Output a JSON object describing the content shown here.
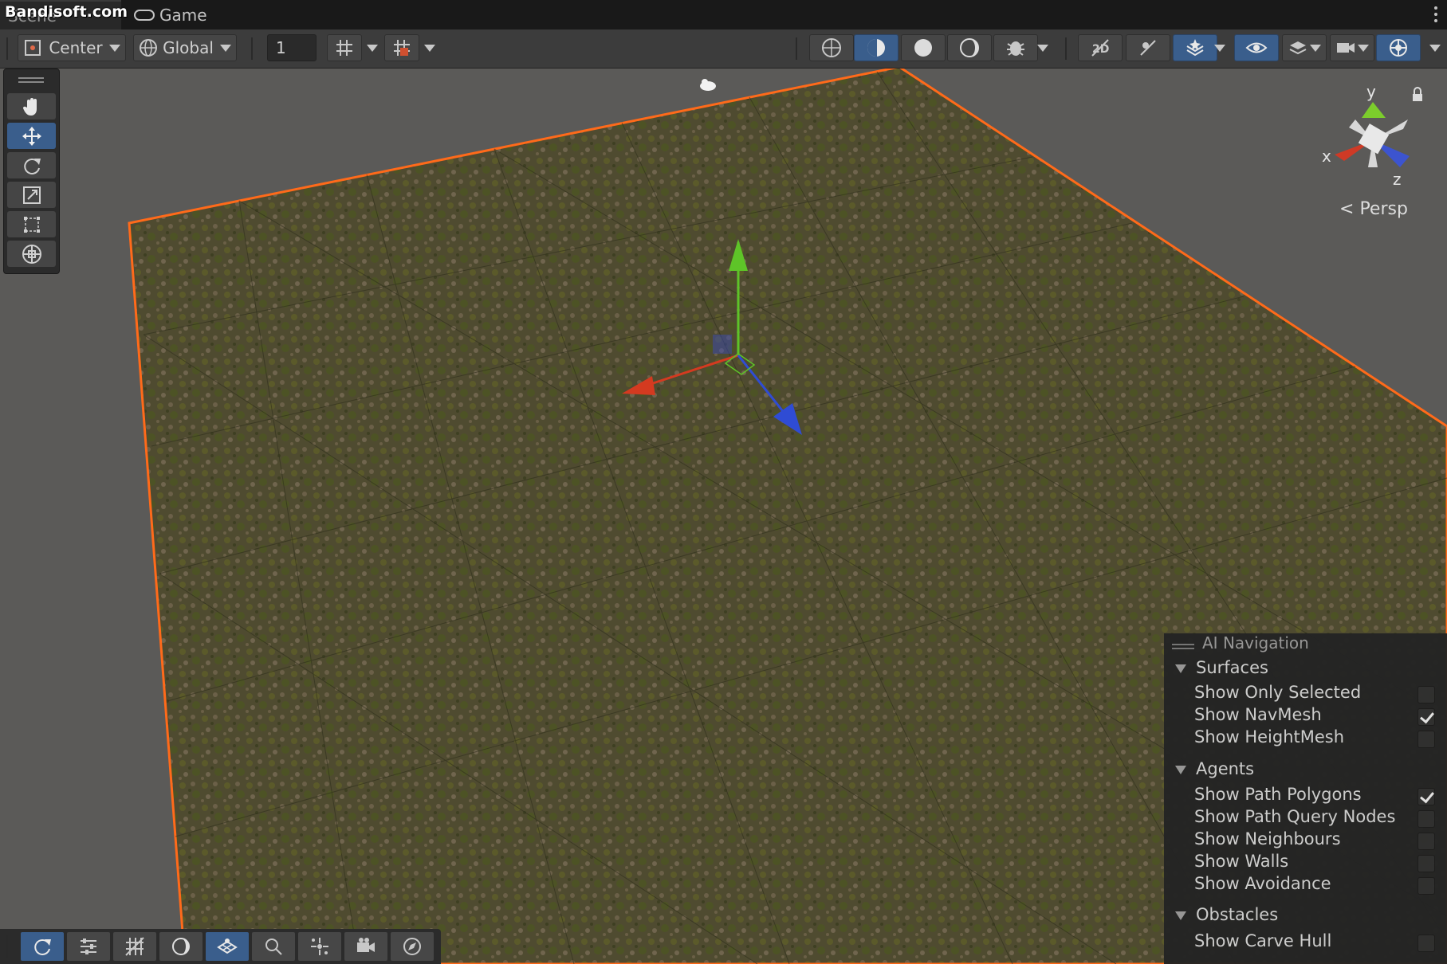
{
  "tabs": {
    "scene_label": "Scene",
    "watermark": "Bandisoft.com",
    "game_label": "Game"
  },
  "toolbar": {
    "pivot_label": "Center",
    "space_label": "Global",
    "grid_increment": "1"
  },
  "viewport": {
    "gizmo_x": "x",
    "gizmo_y": "y",
    "gizmo_z": "z",
    "projection_label": "Persp",
    "selection_outline_color": "#ff6a1a",
    "ground_color": "#4a4a2c"
  },
  "ai_navigation": {
    "title": "AI Navigation",
    "sections": [
      {
        "label": "Surfaces",
        "rows": [
          {
            "label": "Show Only Selected",
            "checked": false
          },
          {
            "label": "Show NavMesh",
            "checked": true
          },
          {
            "label": "Show HeightMesh",
            "checked": false
          }
        ]
      },
      {
        "label": "Agents",
        "rows": [
          {
            "label": "Show Path Polygons",
            "checked": true
          },
          {
            "label": "Show Path Query Nodes",
            "checked": false
          },
          {
            "label": "Show Neighbours",
            "checked": false
          },
          {
            "label": "Show Walls",
            "checked": false
          },
          {
            "label": "Show Avoidance",
            "checked": false
          }
        ]
      },
      {
        "label": "Obstacles",
        "rows": [
          {
            "label": "Show Carve Hull",
            "checked": false
          }
        ]
      }
    ]
  }
}
